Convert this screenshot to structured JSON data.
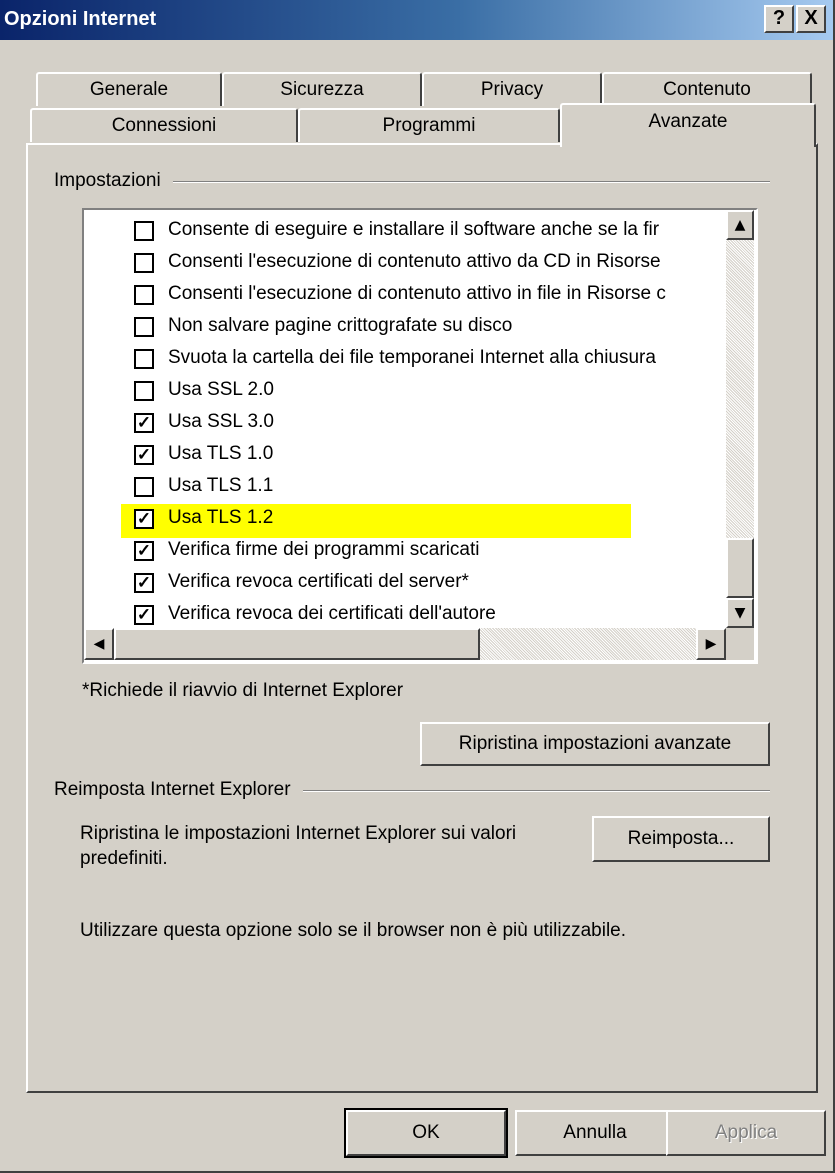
{
  "window": {
    "title": "Opzioni Internet",
    "help_btn": "?",
    "close_btn": "X"
  },
  "tabs": {
    "row1": [
      "Generale",
      "Sicurezza",
      "Privacy",
      "Contenuto"
    ],
    "row2": [
      "Connessioni",
      "Programmi",
      "Avanzate"
    ],
    "active": "Avanzate"
  },
  "settings_group": {
    "title": "Impostazioni",
    "items": [
      {
        "label": "Consente di eseguire e installare il software anche se la fir",
        "checked": false
      },
      {
        "label": "Consenti l'esecuzione di contenuto attivo da CD in Risorse",
        "checked": false
      },
      {
        "label": "Consenti l'esecuzione di contenuto attivo in file in Risorse c",
        "checked": false
      },
      {
        "label": "Non salvare pagine crittografate su disco",
        "checked": false
      },
      {
        "label": "Svuota la cartella dei file temporanei Internet alla chiusura",
        "checked": false
      },
      {
        "label": "Usa SSL 2.0",
        "checked": false
      },
      {
        "label": "Usa SSL 3.0",
        "checked": true
      },
      {
        "label": "Usa TLS 1.0",
        "checked": true
      },
      {
        "label": "Usa TLS 1.1",
        "checked": false
      },
      {
        "label": "Usa TLS 1.2",
        "checked": true,
        "highlighted": true
      },
      {
        "label": "Verifica firme dei programmi scaricati",
        "checked": true
      },
      {
        "label": "Verifica revoca certificati del server*",
        "checked": true
      },
      {
        "label": "Verifica revoca dei certificati dell'autore",
        "checked": true
      }
    ],
    "check_glyph": "✓",
    "highlight_color": "#ffff00",
    "note": "*Richiede il riavvio di Internet Explorer",
    "restore_button": "Ripristina impostazioni avanzate"
  },
  "reset_group": {
    "title": "Reimposta Internet Explorer",
    "description_line1": "Ripristina le impostazioni Internet Explorer sui valori",
    "description_line2": "predefiniti.",
    "reset_button": "Reimposta...",
    "warning": "Utilizzare questa opzione solo se il browser non è più utilizzabile."
  },
  "footer": {
    "ok": "OK",
    "cancel": "Annulla",
    "apply": "Applica"
  },
  "colors": {
    "title_start": "#0a246a",
    "title_end": "#a6caf0",
    "face": "#d4d0c8"
  }
}
